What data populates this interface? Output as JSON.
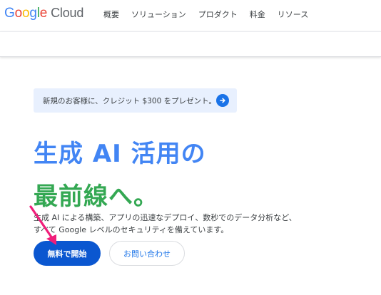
{
  "header": {
    "logo": {
      "google": "Google",
      "cloud": "Cloud"
    },
    "nav": [
      {
        "label": "概要"
      },
      {
        "label": "ソリューション"
      },
      {
        "label": "プロダクト"
      },
      {
        "label": "料金"
      },
      {
        "label": "リソース"
      }
    ]
  },
  "promo": {
    "text": "新規のお客様に、クレジット $300 をプレゼント。",
    "icon": "arrow-forward-icon",
    "accent": "#1a73e8",
    "background": "#e8f0fe"
  },
  "hero": {
    "title_line_1": "生成 AI 活用の",
    "title_line_2": "最前線へ。",
    "title_line_1_color": "#4285f4",
    "title_line_2_color": "#34a853",
    "description_line_1": "生成 AI による構築、アプリの迅速なデプロイ、数秒でのデータ分析など、",
    "description_line_2": "すべて Google レベルのセキュリティを備えています。"
  },
  "actions": {
    "primary_label": "無料で開始",
    "secondary_label": "お問い合わせ",
    "primary_color": "#0b57d0"
  },
  "annotation": {
    "icon": "pointer-arrow-icon",
    "color": "#f01e7a"
  }
}
